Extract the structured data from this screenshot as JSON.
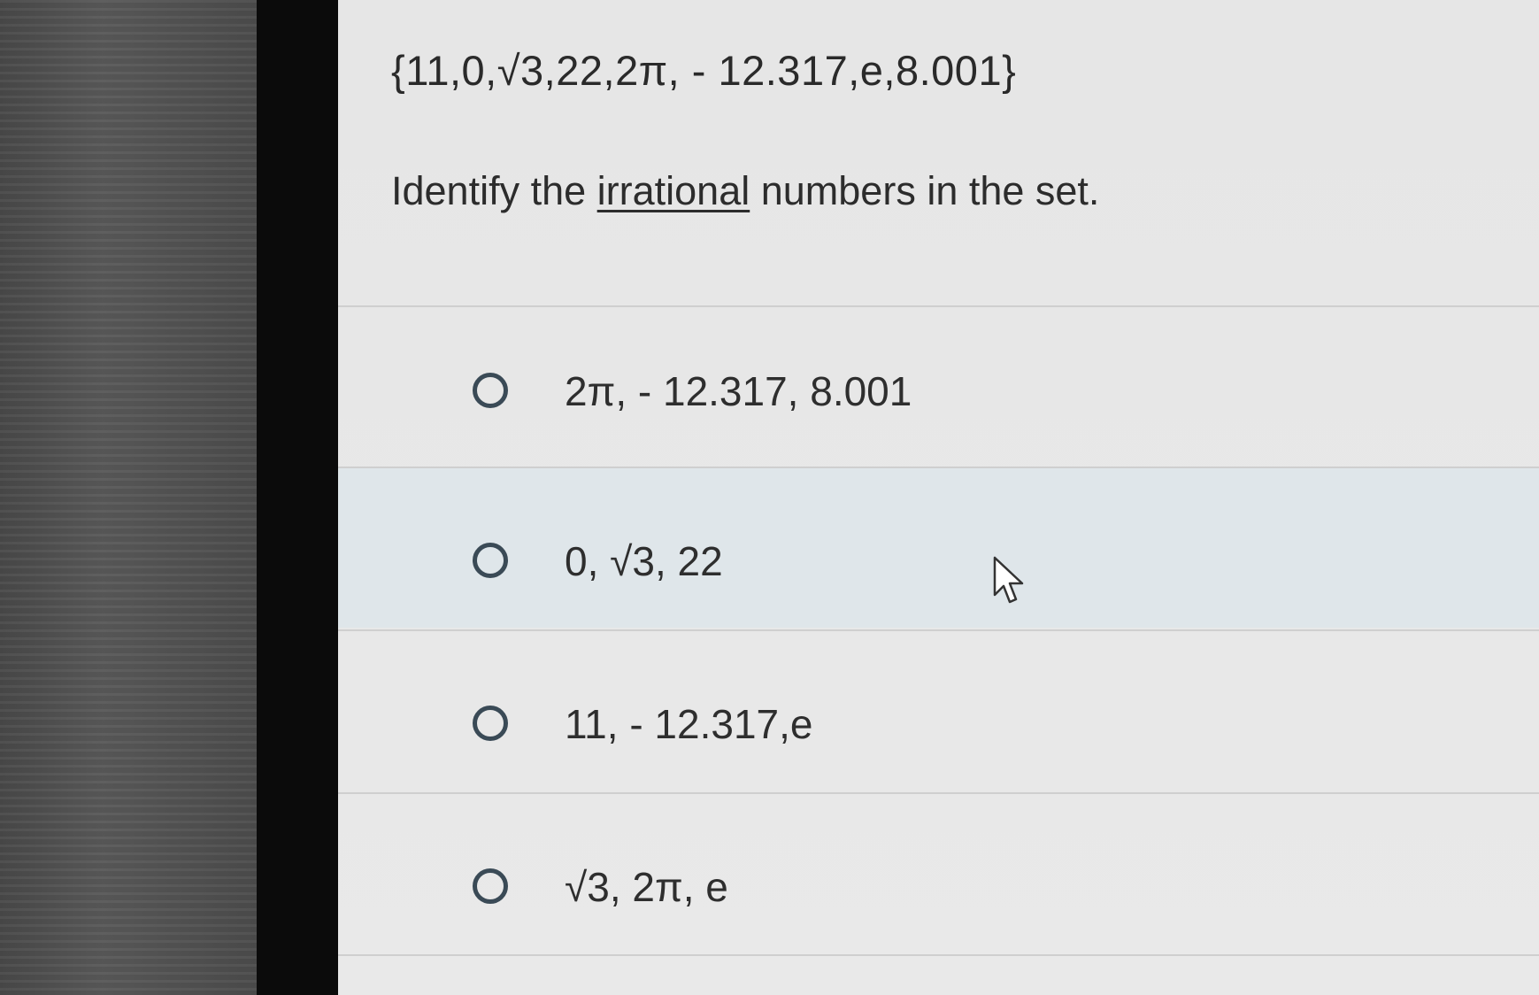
{
  "question": {
    "set_text": "{11,0,√3,22,2π, - 12.317,e,8.001}",
    "prompt_before": "Identify the ",
    "prompt_underlined": "irrational",
    "prompt_after": " numbers in the set."
  },
  "options": [
    {
      "label": "2π, - 12.317, 8.001",
      "selected": false,
      "hovered": false
    },
    {
      "label": "0, √3, 22",
      "selected": false,
      "hovered": true
    },
    {
      "label": "11, - 12.317,e",
      "selected": false,
      "hovered": false
    },
    {
      "label": "√3, 2π, e",
      "selected": false,
      "hovered": false
    }
  ],
  "icons": {
    "cursor": "mouse-pointer-icon"
  },
  "colors": {
    "screen_background": "#e8e8e8",
    "hover_highlight": "#dfe6ea",
    "radio_border": "#3a4a56",
    "text": "#2e2e2e"
  }
}
